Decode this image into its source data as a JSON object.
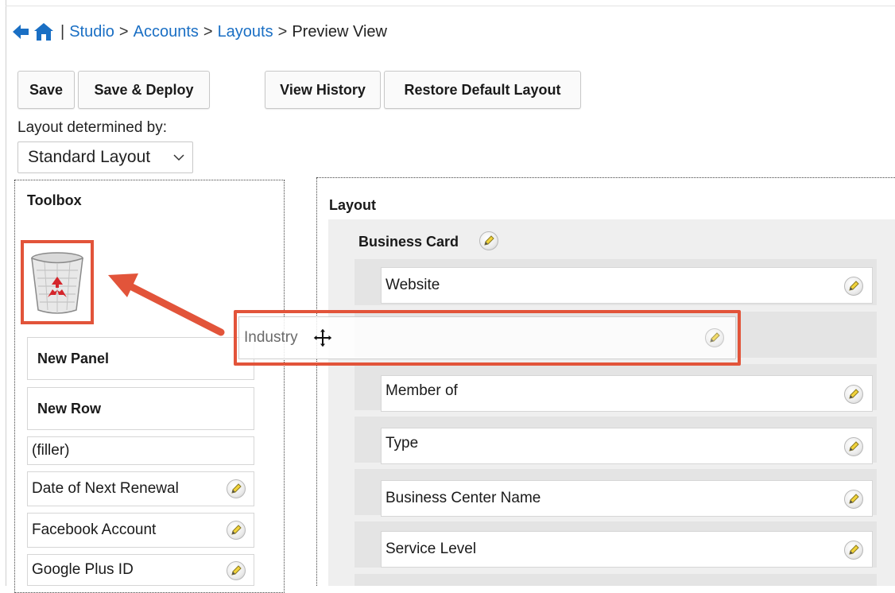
{
  "breadcrumb": {
    "separator": "|",
    "studio": "Studio",
    "arrow": ">",
    "accounts": "Accounts",
    "layouts": "Layouts",
    "current": "Preview View"
  },
  "toolbar": {
    "save": "Save",
    "save_deploy": "Save & Deploy",
    "view_history": "View History",
    "restore_default": "Restore Default Layout"
  },
  "layout_determined_by": {
    "label": "Layout determined by:",
    "selected": "Standard Layout"
  },
  "toolbox": {
    "title": "Toolbox",
    "new_panel": "New Panel",
    "new_row": "New Row",
    "filler": "(filler)",
    "fields": [
      "Date of Next Renewal",
      "Facebook Account",
      "Google Plus ID"
    ]
  },
  "layout": {
    "title": "Layout",
    "panel_name": "Business Card",
    "fields": [
      "Website",
      "Member of",
      "Type",
      "Business Center Name",
      "Service Level"
    ]
  },
  "dragging": {
    "field": "Industry"
  },
  "colors": {
    "link": "#1a6fc4",
    "highlight": "#e2543a",
    "nav_icon": "#1a6fc4"
  },
  "icons": {
    "back": "back-arrow-icon",
    "home": "home-icon",
    "edit": "pencil-icon",
    "trash": "recycle-bin-icon",
    "move": "move-cursor-icon"
  }
}
